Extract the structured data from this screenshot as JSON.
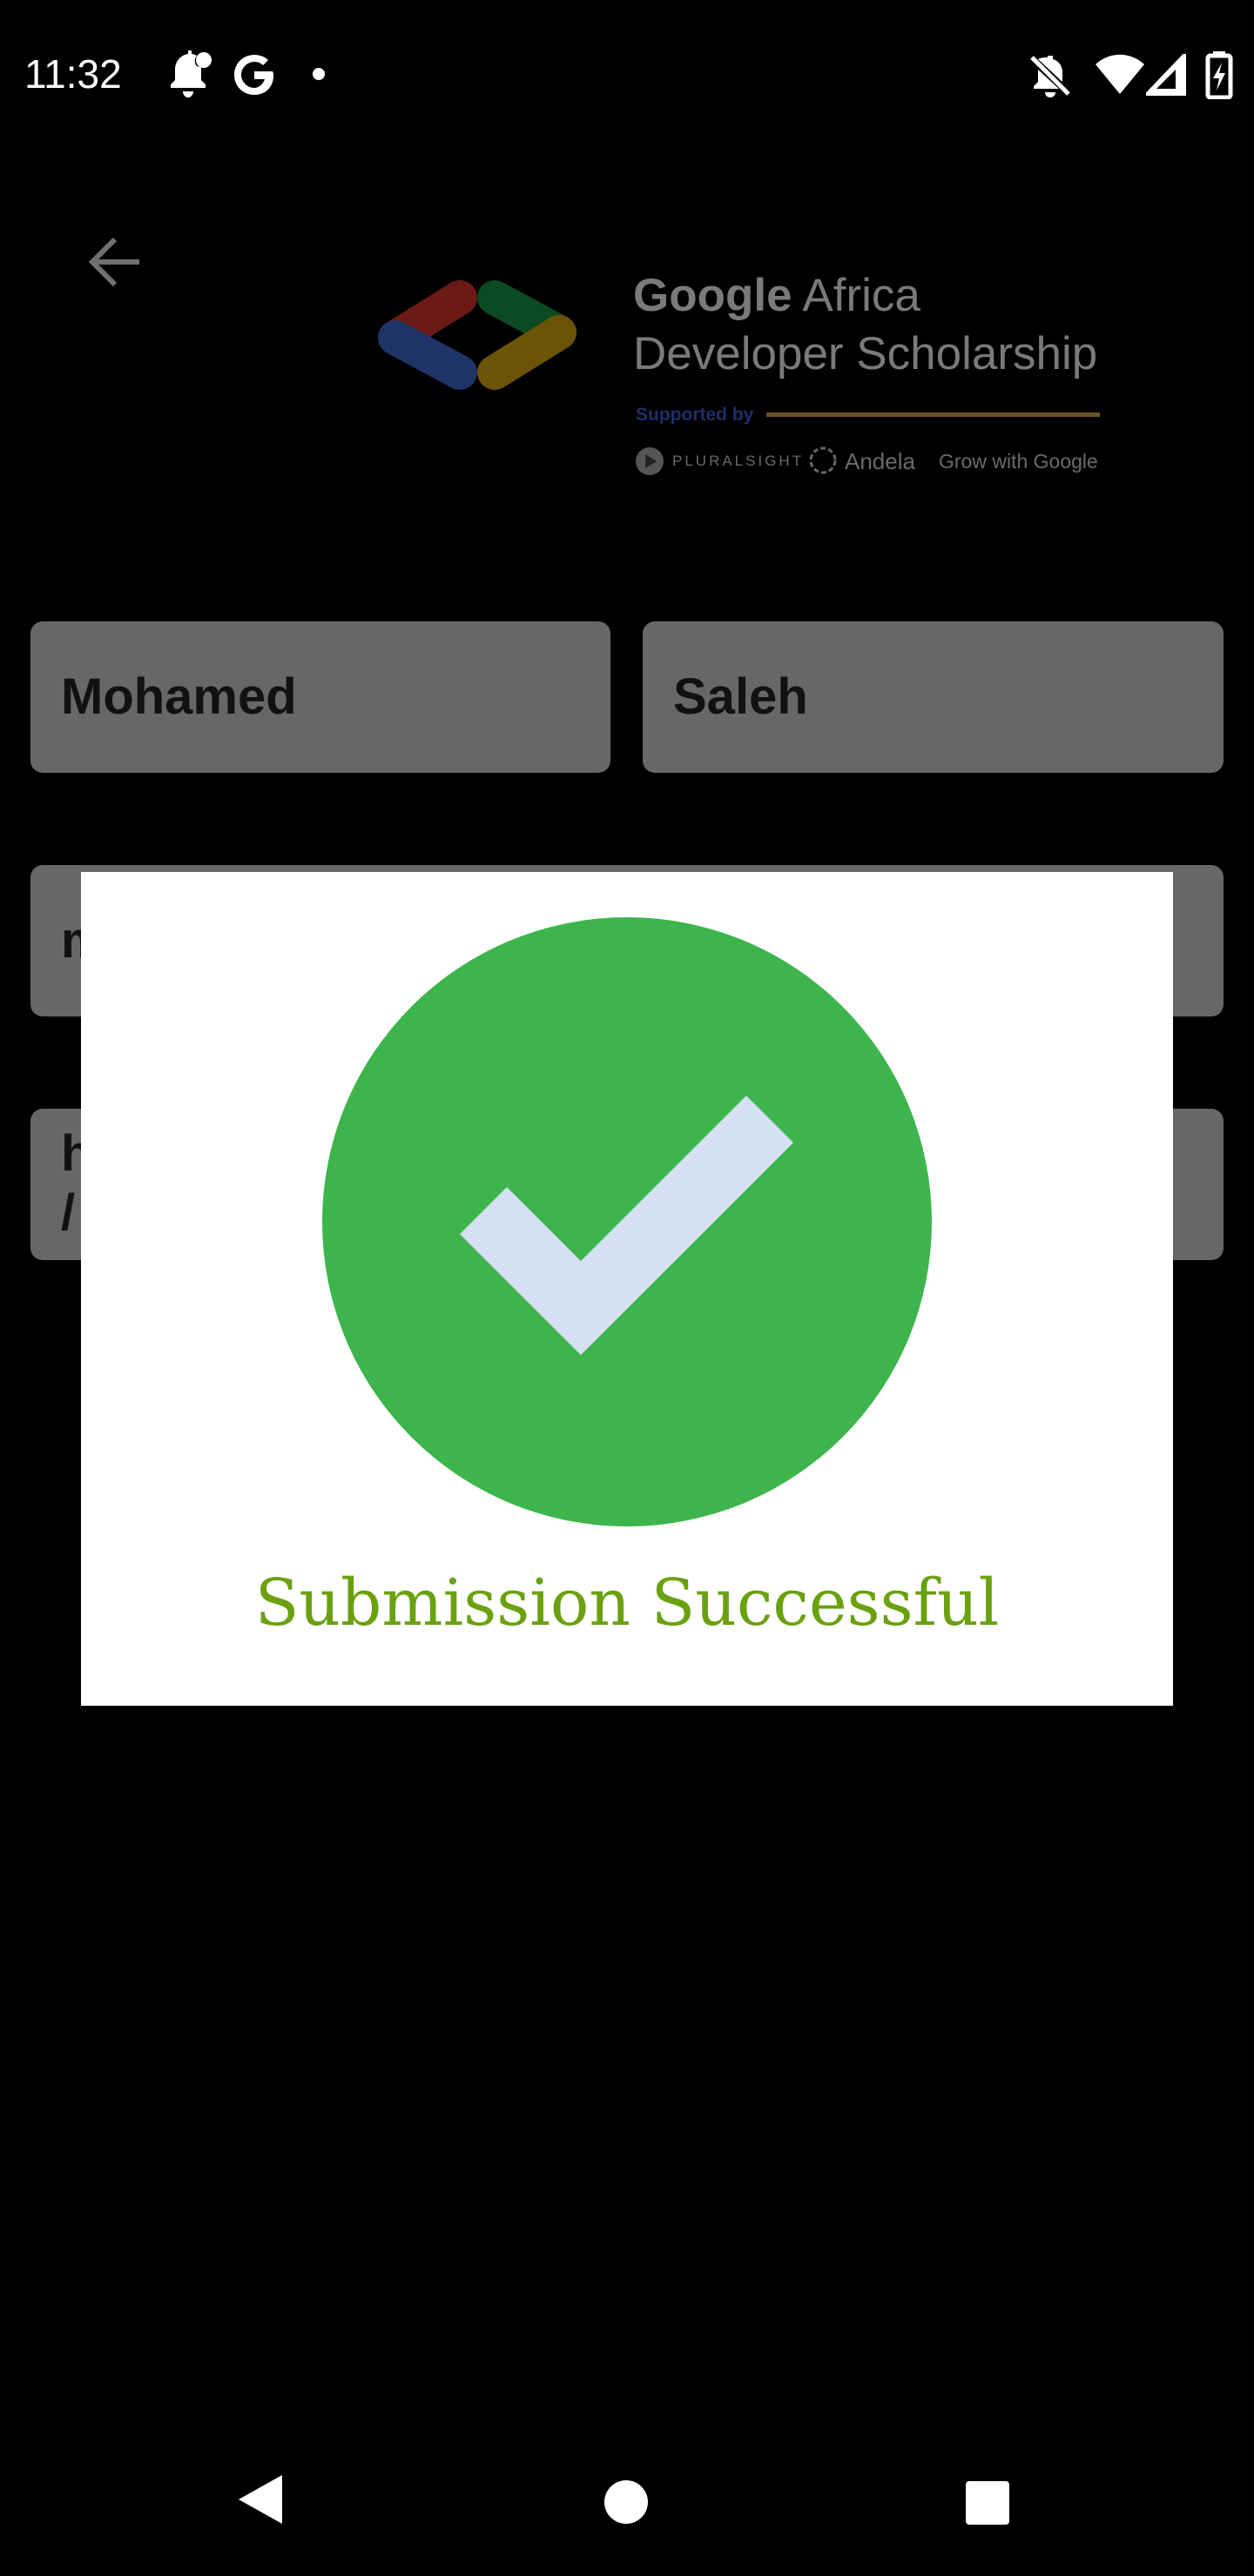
{
  "status_bar": {
    "time": "11:32",
    "left_icons": [
      "notification-bell-icon",
      "google-g-icon",
      "dot-icon"
    ],
    "right_icons": [
      "vibrate-off-icon",
      "wifi-icon",
      "cellular-signal-icon",
      "battery-charging-icon"
    ]
  },
  "header": {
    "back_icon": "arrow-left-icon",
    "brand_bold": "Google",
    "brand_rest": " Africa",
    "brand_line2": "Developer Scholarship",
    "supported_by": "Supported by",
    "partners": {
      "pluralsight": "PLURALSIGHT",
      "andela": "Andela",
      "grow": "Grow with Google"
    }
  },
  "form": {
    "first_name": "Mohamed",
    "last_name": "Saleh",
    "email_partial": "m",
    "github_partial_line1": "h",
    "github_partial_line2": "/"
  },
  "dialog": {
    "icon": "checkmark-circle-icon",
    "message": "Submission Successful",
    "colors": {
      "circle": "#3db54c",
      "check": "#d5e0f3",
      "text": "#6aa10f"
    }
  },
  "nav_bar": {
    "back": "nav-back-icon",
    "home": "nav-home-icon",
    "recents": "nav-recents-icon"
  }
}
